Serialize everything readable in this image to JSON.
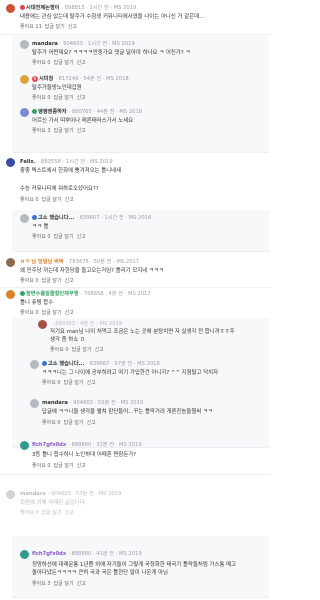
{
  "colors": {
    "accent_red": "#e5474b",
    "accent_blue": "#3b6fd1",
    "accent_green": "#36a465",
    "accent_orange": "#d9822b",
    "meta_gray": "#9aa0a6"
  },
  "comments": [
    {
      "nick": "시대전제논쟁이",
      "meta": "· 898813 · 1시간 전 · MS 2019",
      "lines": [
        "내용에는 관심 없는데 탈주가 수험생 커뮤니티에서였을 나이는 아니신 거 같은데..."
      ],
      "actions": [
        "좋아요 11",
        "답글 달기",
        "신고"
      ]
    },
    {
      "nick": "mandara",
      "meta": "· 904603 · 1시간 전 · MS 2019",
      "lines": [
        "탈주가 어떤데요? ㅋㅋㅋㅋ만중가요 댓글 달아야 하나요 ㅋ 어진가? ㅋ"
      ],
      "actions": [
        "좋아요 0",
        "답글 달기",
        "신고"
      ]
    },
    {
      "nick": "시미칭",
      "meta": "· 817249 · 54분 전 · MS 2018",
      "lines": [
        "탈주가들방노인데겁원"
      ],
      "actions": [
        "좋아요 0",
        "답글 달기",
        "신고"
      ]
    },
    {
      "nick": "엥엥엔중하자",
      "meta": "· 800765 · 44분 전 · MS 2018",
      "lines": [
        "어르신 가서 띠뿌이나 래른태라스가서 노세요"
      ],
      "actions": [
        "좋아요 3",
        "답글 달기",
        "신고"
      ]
    },
    {
      "nick": "Felix.",
      "meta": "· 883558 · 1시간 전 · MS 2019",
      "lines": [
        "좋좋 텍스트에서 한화에 뿡겨져오는 틀니네새",
        "",
        "수능 커뮤니티에 워하로오셨어요??"
      ],
      "actions": [
        "좋아요 0",
        "답글 달기",
        "신고"
      ]
    },
    {
      "nick": "고소 했습니다...",
      "meta": "· 839667 · 1시간 전 · MS 2018",
      "lines": [
        "ㅋㅋ 틀"
      ],
      "actions": [
        "좋아요 0",
        "답글 달기",
        "신고"
      ]
    },
    {
      "nick": "ㅂㅋ 님 엉덩님 벅벅",
      "meta": "· 783475 · 50분 전 · MS 2017",
      "lines": [
        "왜 민주당 까는데 자한당을 들고오는거임? 틀리기 모지네 ㅋㅋㅋ"
      ],
      "actions": [
        "좋아요 0",
        "답글 달기",
        "신고"
      ]
    },
    {
      "nick": "정변수를알줄힐인재무쟁",
      "meta": "· 768658 · 4분 전 · MS 2017",
      "lines": [
        "틀니 퓨탱 합수"
      ],
      "actions": [
        "좋아요 0",
        "답글 달기",
        "신고"
      ]
    },
    {
      "nick": "",
      "meta": "· 889353 · 4분 전 · MS 2019",
      "lines": [
        "저기요 man님 나이 처먹고 조금은 노는 곳에 분탕치면 자 살생각 전 합니까ㅎㅎ주",
        "생각 좀 하쇼 ㅍ"
      ],
      "actions": [
        "좋아요 0",
        "답글 달기",
        "신고"
      ]
    },
    {
      "nick": "고소 했습니다...",
      "meta": "· 839667 · 57분 전 · MS 2018",
      "lines": [
        "ㅋㅋㅋ니는 그 나이에 공부하려고 여기 가입한건 아니지? ^^ 지형탈고 닥치자"
      ],
      "actions": [
        "좋아요 0",
        "답글 달기",
        "신고"
      ]
    },
    {
      "nick": "mandara",
      "meta": "· 904603 · 55분 전 · MS 2019",
      "lines": [
        "답글에 ㅋㅋ니들 생각을 펼쳐 판단들어...꾸는 틀딱거려 개론진놈들뭘써 ㅋㅋ"
      ],
      "actions": [
        "좋아요 0",
        "답글 달기",
        "신고"
      ]
    },
    {
      "nick": "flch7gfx0dx",
      "meta": "· 888860 · 32분 전 · MS 2019",
      "lines": [
        "3등 틀니 합수하니 노인하대 어때혼 쪈참돈가?"
      ],
      "actions": [
        "좋아요 0",
        "답글 달기",
        "신고"
      ]
    },
    {
      "nick": "mandara",
      "meta": "· 904603 · 53분 전 · MS 2019",
      "lines": [
        "회원에 의해 삭제된 글입니다."
      ],
      "actions": [
        "좋아요 0",
        "답글 달기",
        "신고"
      ]
    },
    {
      "nick": "flch7gfx0dx",
      "meta": "· 888860 · 41분 전 · MS 2019",
      "lines": [
        "정망하선에 대례문통 1년쯤 외에 자기들이 그렇게 국정화한 태국기 틀락들처럼 가스통 메고",
        "돌아다녔든ㅋㅋㅋㅋ 큰히 국과 국은 틀한단 말이 나온게 아님"
      ],
      "actions": [
        "좋아요 3",
        "답글 달기",
        "신고"
      ]
    }
  ]
}
